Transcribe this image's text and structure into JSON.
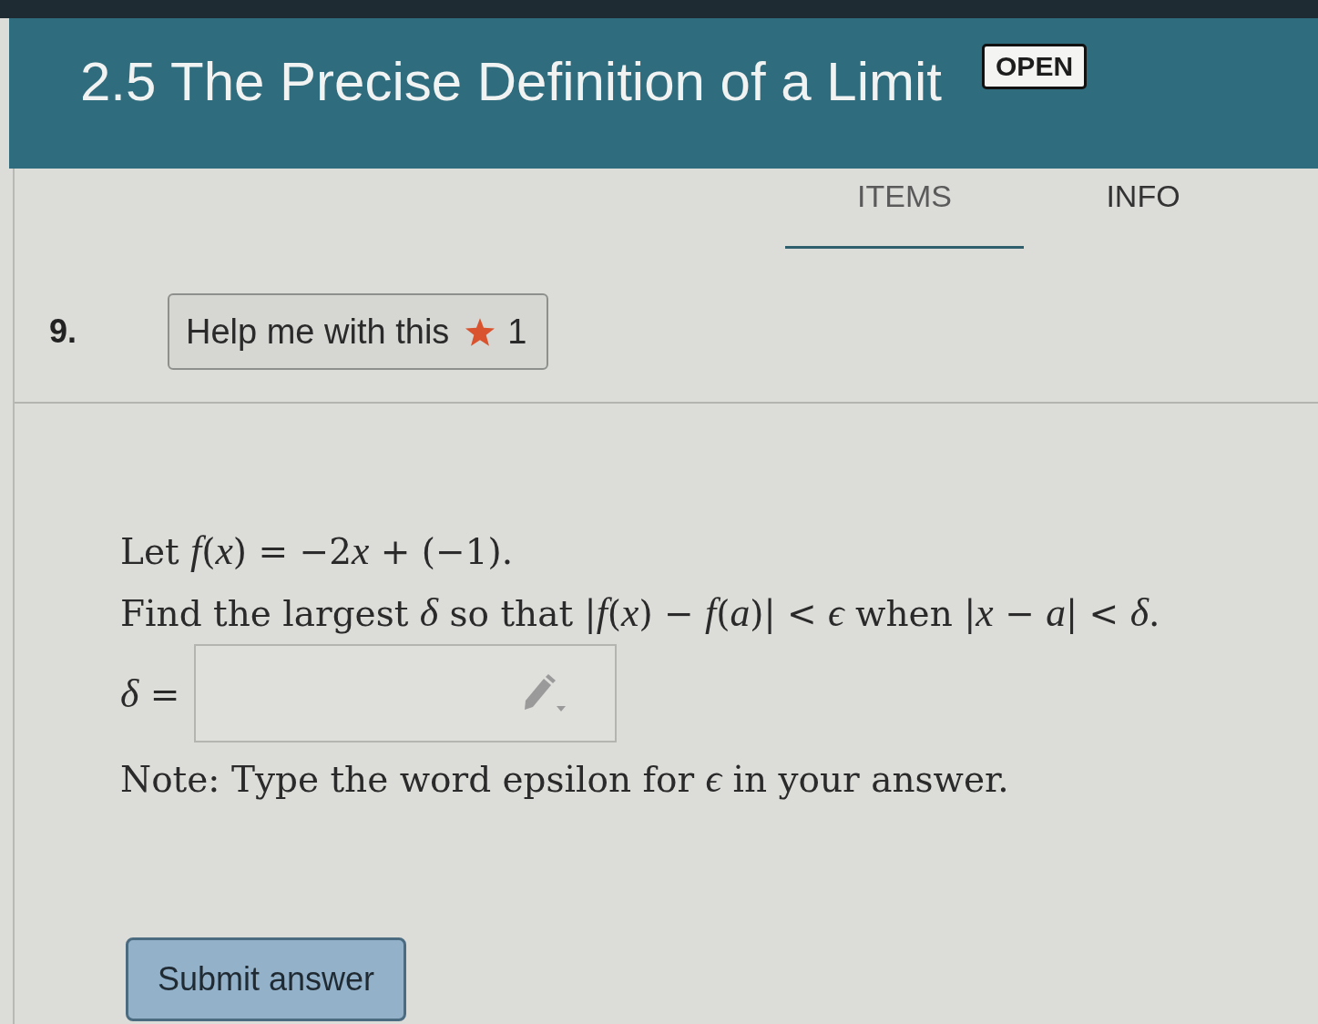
{
  "header": {
    "title": "2.5 The Precise Definition of a Limit",
    "badge": "OPEN"
  },
  "tabs": [
    {
      "label": "ITEMS",
      "selected": true
    },
    {
      "label": "INFO",
      "selected": false
    }
  ],
  "question": {
    "number": "9.",
    "help_button": {
      "label": "Help me with this",
      "count": "1"
    },
    "lines": [
      {
        "runs": [
          {
            "text": "Let ",
            "italic": false
          },
          {
            "text": "f",
            "italic": true
          },
          {
            "text": "(",
            "italic": false
          },
          {
            "text": "x",
            "italic": true
          },
          {
            "text": ") = −2",
            "italic": false
          },
          {
            "text": "x",
            "italic": true
          },
          {
            "text": " + (−1).",
            "italic": false
          }
        ]
      },
      {
        "runs": [
          {
            "text": "Find the largest ",
            "italic": false
          },
          {
            "text": "δ",
            "italic": true
          },
          {
            "text": " so that |",
            "italic": false
          },
          {
            "text": "f",
            "italic": true
          },
          {
            "text": "(",
            "italic": false
          },
          {
            "text": "x",
            "italic": true
          },
          {
            "text": ") − ",
            "italic": false
          },
          {
            "text": "f",
            "italic": true
          },
          {
            "text": "(",
            "italic": false
          },
          {
            "text": "a",
            "italic": true
          },
          {
            "text": ")| < ",
            "italic": false
          },
          {
            "text": "ϵ",
            "italic": true
          },
          {
            "text": " when |",
            "italic": false
          },
          {
            "text": "x",
            "italic": true
          },
          {
            "text": " − ",
            "italic": false
          },
          {
            "text": "a",
            "italic": true
          },
          {
            "text": "| < ",
            "italic": false
          },
          {
            "text": "δ",
            "italic": true
          },
          {
            "text": ".",
            "italic": false
          }
        ]
      }
    ],
    "answer": {
      "label": "*δ* ="
    },
    "note": "Note: Type the word epsilon for *ϵ* in your answer."
  },
  "submit_button": "Submit answer"
}
